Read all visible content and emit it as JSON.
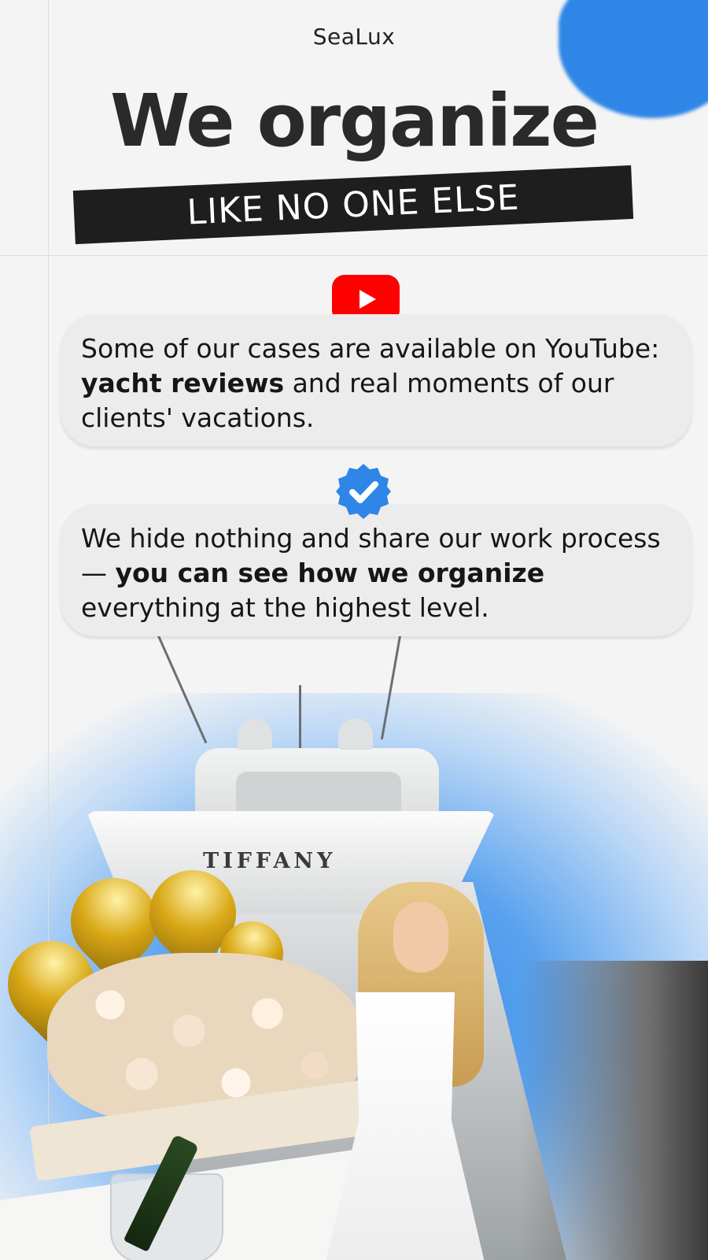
{
  "brand": "SeaLux",
  "headline": "We organize",
  "banner": "LIKE NO ONE ELSE",
  "card_youtube": {
    "icon": "youtube-icon",
    "text_before": "Some of our cases are available on YouTube: ",
    "text_bold": "yacht reviews",
    "text_after": " and real moments of our clients' vacations."
  },
  "card_process": {
    "icon": "verified-badge-icon",
    "text_before": "We hide nothing and share our work process — ",
    "text_bold": "you can see how we organize",
    "text_after": " everything at the highest level."
  },
  "photo": {
    "yacht_name": "TIFFANY"
  },
  "colors": {
    "accent_blue": "#2f86e6",
    "youtube_red": "#ff0000",
    "banner_black": "#1e1e1e",
    "card_bg": "#ececec"
  }
}
